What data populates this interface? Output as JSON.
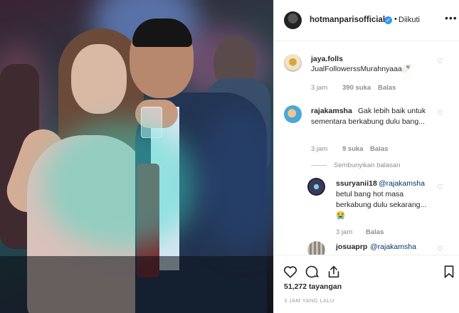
{
  "header": {
    "username": "hotmanparisofficial",
    "separator": "•",
    "follow_status": "Diikuti",
    "more_label": "•••"
  },
  "comments": [
    {
      "username": "jaya.folls",
      "text": "JualFollowerssMurahnyaaa🍼",
      "time": "3 jam",
      "likes": "390 suka",
      "reply": "Balas"
    },
    {
      "username": "rajakamsha",
      "text": "Gak lebih baik untuk sementara berkabung dulu bang...",
      "time": "3 jam",
      "likes": "9 suka",
      "reply": "Balas",
      "hide_replies": "Sembunyikan balasan",
      "replies": [
        {
          "username": "ssuryanii18",
          "mention": "@rajakamsha",
          "text": "betul bang hot masa berkabung dulu sekarang...😭",
          "time": "3 jam",
          "reply": "Balas"
        },
        {
          "username": "josuaprp",
          "mention": "@rajakamsha"
        }
      ]
    }
  ],
  "footer": {
    "likes_count": "51,272",
    "likes_label": "tayangan",
    "timestamp": "3 JAM YANG LALU"
  },
  "colors": {
    "verified_badge": "#3897f0",
    "mention": "#003569",
    "meta_gray": "#8e8e8e"
  },
  "icons": [
    "heart-icon",
    "comment-icon",
    "share-icon",
    "bookmark-icon",
    "verified-badge-icon",
    "more-options-icon"
  ]
}
